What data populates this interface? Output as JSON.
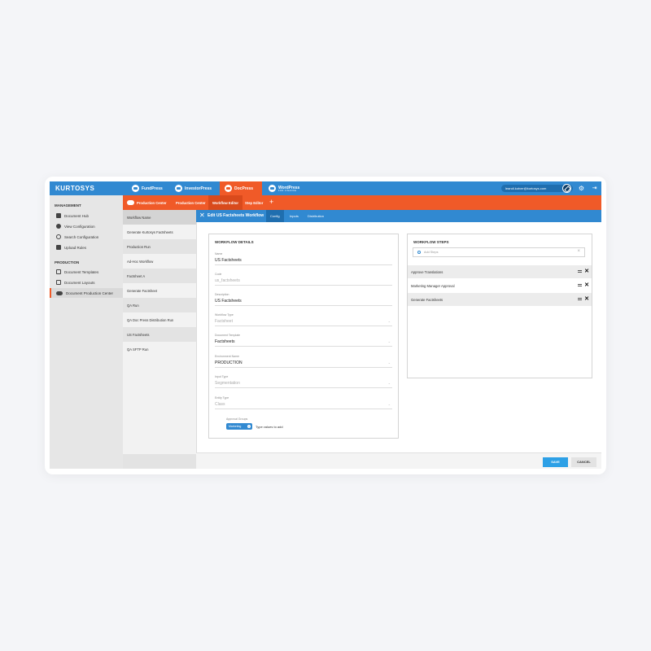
{
  "brand": "KURTOSYS",
  "products": [
    {
      "label": "FundPress"
    },
    {
      "label": "InvestorPress"
    },
    {
      "label": "DocPress"
    },
    {
      "label": "WordPress",
      "sub": "FOR FINANCE"
    }
  ],
  "user": {
    "email": "leandi.kotver@kurtosys.com"
  },
  "sidebar": {
    "management_heading": "MANAGEMENT",
    "management_items": [
      {
        "label": "Document Hub"
      },
      {
        "label": "View Configuration"
      },
      {
        "label": "Search Configuration"
      },
      {
        "label": "Upload Rules"
      }
    ],
    "production_heading": "PRODUCTION",
    "production_items": [
      {
        "label": "Document Templates"
      },
      {
        "label": "Document Layouts"
      },
      {
        "label": "Document Production Center"
      }
    ]
  },
  "subnav": {
    "items": [
      "Production Center",
      "Production Center",
      "Workflow Editor",
      "Step Editor"
    ]
  },
  "workflow_list": {
    "header": "Workflow Name",
    "rows": [
      "Generate Kurtosys Factsheets",
      "Production Run",
      "Ad-Hoc Workflow",
      "Factsheet A",
      "Generate Factsheet",
      "QA Run",
      "QA Doc Press Distribution Run",
      "US Factsheets",
      "QA SFTP Run"
    ]
  },
  "panel": {
    "title": "Edit US Factsheets Workflow",
    "tabs": [
      "Config",
      "Inputs",
      "Distribution"
    ]
  },
  "details": {
    "title": "WORKFLOW DETAILS",
    "fields": [
      {
        "label": "Name",
        "value": "US Factsheets"
      },
      {
        "label": "Code",
        "value": "us_factsheets"
      },
      {
        "label": "Description",
        "value": "US Factsheets"
      },
      {
        "label": "Workflow Type",
        "value": "Factsheet"
      },
      {
        "label": "Document Template",
        "value": "Factsheets"
      },
      {
        "label": "Environment Name",
        "value": "PRODUCTION"
      },
      {
        "label": "Input Type",
        "value": "Segmentation"
      },
      {
        "label": "Entity Type",
        "value": "Class"
      }
    ],
    "approval_label": "Approval Groups",
    "approval_tag": "Marketing",
    "approval_input": "Type values to add"
  },
  "steps": {
    "title": "WORKFLOW STEPS",
    "search_placeholder": "Add Steps",
    "items": [
      "Approve Translations",
      "Marketing Manager Approval",
      "Generate Factsheets"
    ]
  },
  "actions": {
    "save": "SAVE",
    "cancel": "CANCEL"
  }
}
